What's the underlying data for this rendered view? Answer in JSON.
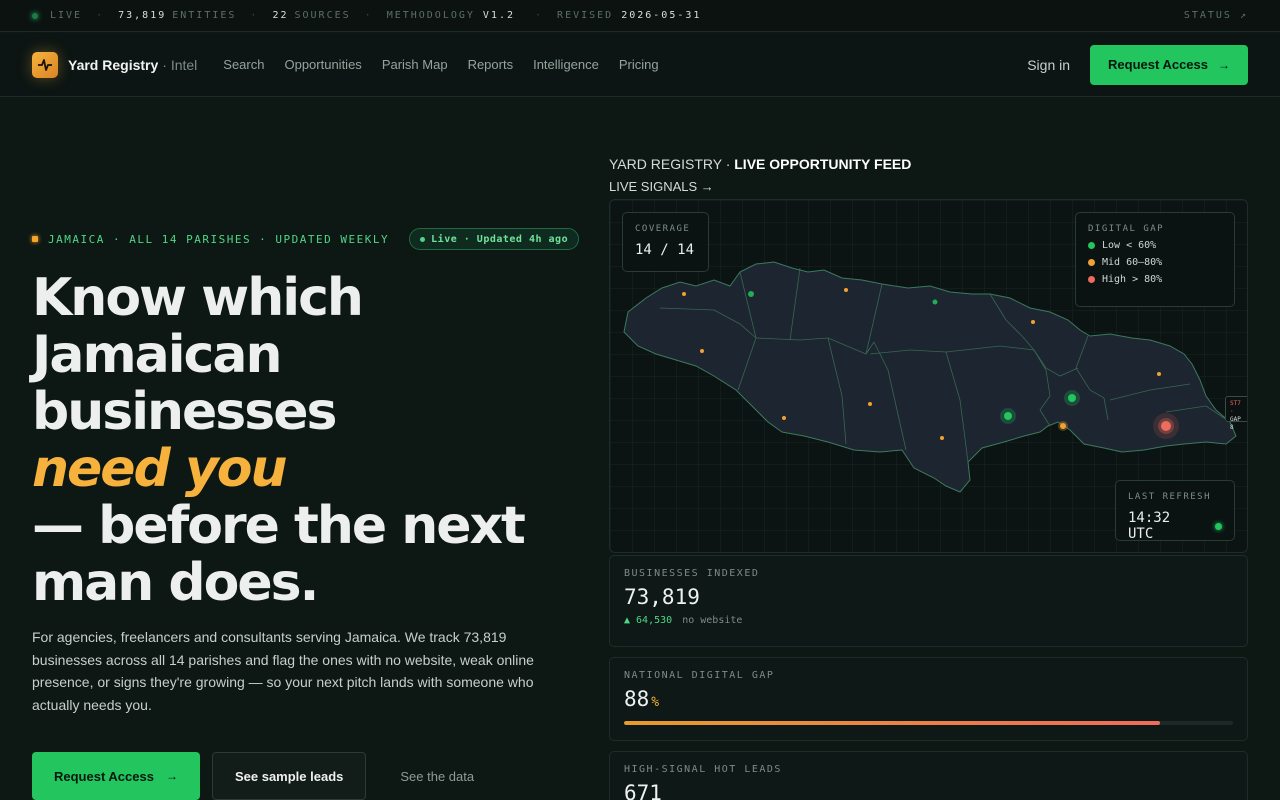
{
  "statusbar": {
    "live": "LIVE",
    "entities_value": "73,819",
    "entities_label": "ENTITIES",
    "sources_value": "22",
    "sources_label": "SOURCES",
    "methodology_label": "METHODOLOGY",
    "methodology_value": "V1.2",
    "revised_label": "REVISED",
    "revised_value": "2026-05-31",
    "status": "STATUS ↗"
  },
  "nav": {
    "brand": "Yard Registry",
    "brand_sub": "· Intel",
    "links": [
      "Search",
      "Opportunities",
      "Parish Map",
      "Reports",
      "Intelligence",
      "Pricing"
    ],
    "signin": "Sign in",
    "cta": "Request Access",
    "cta_arrow": "→"
  },
  "hero": {
    "eyebrow": "JAMAICA · ALL 14 PARISHES · UPDATED WEEKLY",
    "live_pill": "Live · Updated 4h ago",
    "headline": {
      "line1": "Know which",
      "line2": "Jamaican",
      "line3": "businesses",
      "accent": "need you",
      "line5": "— before the next",
      "line6": "man does."
    },
    "lede": "For agencies, freelancers and consultants serving Jamaica. We track 73,819 businesses across all 14 parishes and flag the ones with no website, weak online presence, or signs they're growing — so your next pitch lands with someone who actually needs you.",
    "primary_button": "Request Access",
    "primary_arrow": "→",
    "secondary_button": "See sample leads",
    "ghost_button": "See the data"
  },
  "feed": {
    "title_prefix": "YARD REGISTRY ·",
    "title_main": "LIVE OPPORTUNITY FEED",
    "subtitle": "LIVE SIGNALS →",
    "coverage_label": "COVERAGE",
    "coverage_value": "14 / 14",
    "gap_label": "DIGITAL GAP",
    "gap_legend": [
      {
        "label": "Low < 60%",
        "color": "#22c55e"
      },
      {
        "label": "Mid 60–80%",
        "color": "#f0a132"
      },
      {
        "label": "High > 80%",
        "color": "#ef6b5a"
      }
    ],
    "refresh_label": "LAST REFRESH",
    "refresh_value": "14:32 UTC",
    "edge_tag_top": "ST7 ·",
    "edge_tag_bottom": "GAP 8"
  },
  "stats": {
    "indexed_label": "BUSINESSES INDEXED",
    "indexed_value": "73,819",
    "indexed_note_value": "▲ 64,530",
    "indexed_note_label": "no website",
    "gap_label": "NATIONAL DIGITAL GAP",
    "gap_value": "88",
    "gap_unit": "%",
    "gap_fill_percent": 88,
    "hot_label": "HIGH-SIGNAL HOT LEADS",
    "hot_value": "671"
  },
  "colors": {
    "accent_green": "#22c55e",
    "accent_amber": "#f6b23c",
    "accent_red": "#ef6b5a",
    "background": "#0d1714"
  }
}
